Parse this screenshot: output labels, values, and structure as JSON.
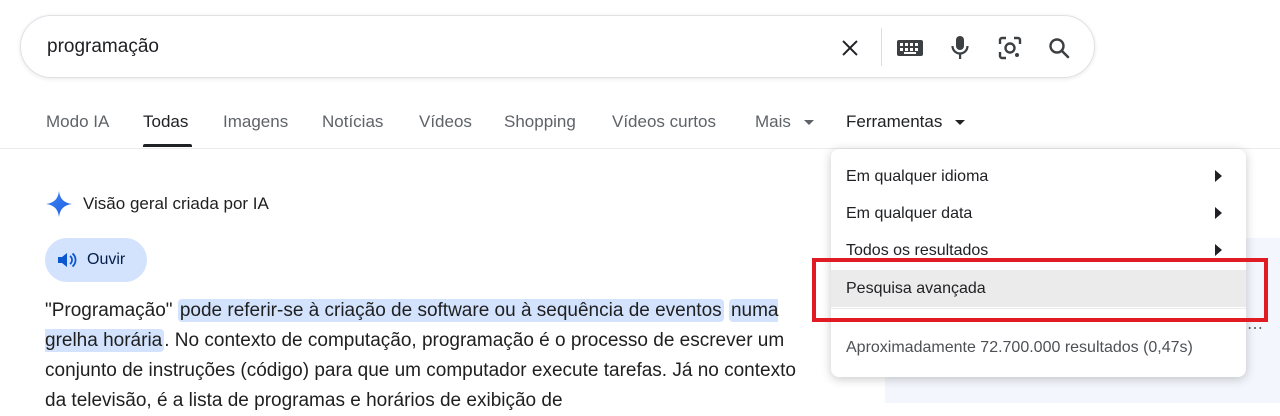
{
  "search": {
    "query": "programação"
  },
  "tabs": [
    {
      "label": "Modo IA"
    },
    {
      "label": "Todas"
    },
    {
      "label": "Imagens"
    },
    {
      "label": "Notícias"
    },
    {
      "label": "Vídeos"
    },
    {
      "label": "Shopping"
    },
    {
      "label": "Vídeos curtos"
    },
    {
      "label": "Mais"
    }
  ],
  "tools_label": "Ferramentas",
  "ai_overview": {
    "title": "Visão geral criada por IA",
    "listen_label": "Ouvir",
    "text_prefix": "\"Programação\" ",
    "text_highlight_1": "pode referir-se à criação de software ou à sequência de eventos",
    "text_highlight_2": "numa grelha horária",
    "text_rest": ". No contexto de computação, programação é o processo de escrever um conjunto de instruções (código) para que um computador execute tarefas. Já no contexto da televisão, é a lista de programas e horários de exibição de"
  },
  "tools_menu": {
    "items": [
      {
        "label": "Em qualquer idioma"
      },
      {
        "label": "Em qualquer data"
      },
      {
        "label": "Todos os resultados"
      },
      {
        "label": "Pesquisa avançada"
      }
    ],
    "stats": "Aproximadamente 72.700.000 resultados (0,47s)"
  },
  "colors": {
    "accent_highlight": "#d3e3fd",
    "annotation_box": "#e01b24",
    "active_tab": "#202124"
  }
}
